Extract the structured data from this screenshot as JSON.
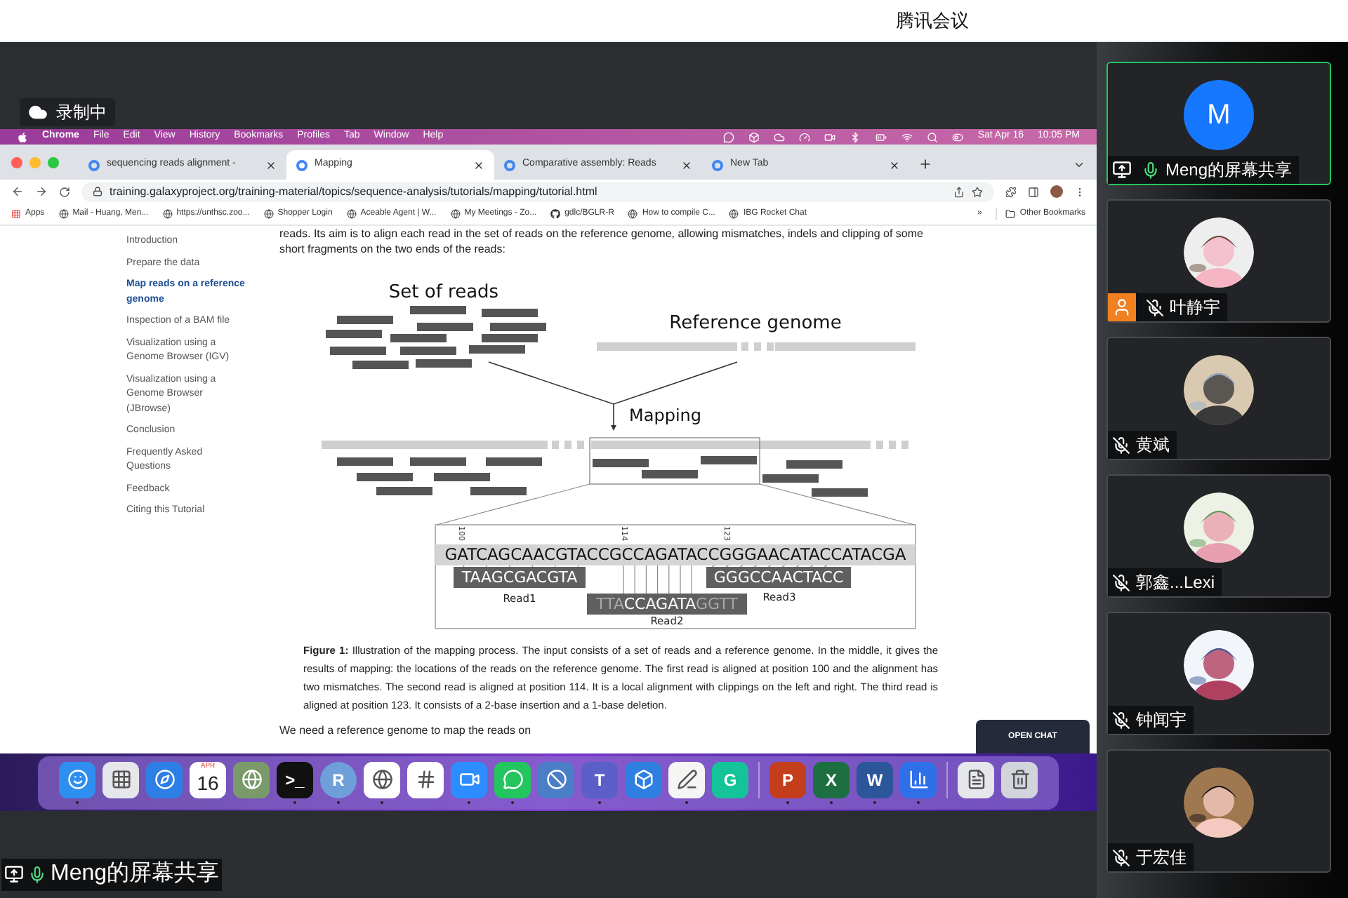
{
  "app_title": "腾讯会议",
  "recording": {
    "label": "录制中"
  },
  "menubar": {
    "items": [
      "Chrome",
      "File",
      "Edit",
      "View",
      "History",
      "Bookmarks",
      "Profiles",
      "Tab",
      "Window",
      "Help"
    ],
    "date": "Sat Apr 16",
    "time": "10:05 PM"
  },
  "browser": {
    "tabs": [
      {
        "title": "sequencing reads alignment - ",
        "selected": false
      },
      {
        "title": "Mapping",
        "selected": true
      },
      {
        "title": "Comparative assembly: Reads",
        "selected": false
      },
      {
        "title": "New Tab",
        "selected": false
      }
    ],
    "address": "training.galaxyproject.org/training-material/topics/sequence-analysis/tutorials/mapping/tutorial.html",
    "bookmarks": [
      "Apps",
      "Mail - Huang, Men...",
      "https://unthsc.zoo...",
      "Shopper Login",
      "Aceable Agent | W...",
      "My Meetings - Zo...",
      "gdlc/BGLR-R",
      "How to compile C...",
      "IBG Rocket Chat"
    ],
    "bookmarks_more": "»",
    "other_bookmarks": "Other Bookmarks"
  },
  "sidebar": {
    "items": [
      {
        "label": "Introduction",
        "selected": false
      },
      {
        "label": "Prepare the data",
        "selected": false
      },
      {
        "label": "Map reads on a reference genome",
        "selected": true
      },
      {
        "label": "Inspection of a BAM file",
        "selected": false
      },
      {
        "label": "Visualization using a Genome Browser (IGV)",
        "selected": false
      },
      {
        "label": "Visualization using a Genome Browser (JBrowse)",
        "selected": false
      },
      {
        "label": "Conclusion",
        "selected": false
      },
      {
        "label": "Frequently Asked Questions",
        "selected": false
      },
      {
        "label": "Feedback",
        "selected": false
      },
      {
        "label": "Citing this Tutorial",
        "selected": false
      }
    ]
  },
  "article": {
    "intro": "reads. Its aim is to align each read in the set of reads on the reference genome, allowing mismatches, indels and clipping of some short fragments on the two ends of the reads:",
    "figure": {
      "reads_title": "Set of reads",
      "reference_title": "Reference genome",
      "mapping_label": "Mapping",
      "positions": [
        "100",
        "114",
        "123"
      ],
      "reference_sequence": "GATCAGCAACGTACCGCCAGATACCGGGAACATACCATACGA",
      "reads": [
        {
          "label": "Read1",
          "sequence": "TAAGCGACGTA"
        },
        {
          "label": "Read2",
          "left_clip": "TTA",
          "sequence": "CCAGATA",
          "right_clip": "GGTT"
        },
        {
          "label": "Read3",
          "sequence": "GGGCCAACTACC"
        }
      ]
    },
    "caption": "**Figure 1:** Illustration of the mapping process. The input consists of a set of reads and a reference genome. In the middle, it gives the results of mapping: the locations of the reads on the reference genome. The first read is aligned at position 100 and the alignment has two mismatches. The second read is aligned at position 114. It is a local alignment with clippings on the left and right. The third read is aligned at position 123. It consists of a 2-base insertion and a 1-base deletion.",
    "next": "We need a reference genome to map the reads on"
  },
  "open_chat": "OPEN CHAT",
  "dock": [
    {
      "kind": "face",
      "color": "#2f8ff0",
      "running": true
    },
    {
      "kind": "grid",
      "color": "#e5e7eb",
      "running": false
    },
    {
      "kind": "compass",
      "color": "#2d7fe6",
      "running": false
    },
    {
      "kind": "calendar",
      "month": "APR",
      "day": "16",
      "running": false
    },
    {
      "kind": "ring",
      "color": "#7a9a6a",
      "running": false
    },
    {
      "kind": "letter",
      "glyph": ">_",
      "color": "#111111",
      "running": true
    },
    {
      "kind": "letter",
      "glyph": "R",
      "color": "#6f9fd8",
      "running": true
    },
    {
      "kind": "chrome",
      "color": "#ffffff",
      "running": true
    },
    {
      "kind": "hash",
      "color": "#ffffff",
      "running": false
    },
    {
      "kind": "video",
      "color": "#2d8cff",
      "running": true
    },
    {
      "kind": "chat",
      "color": "#22c55e",
      "running": true
    },
    {
      "kind": "ban",
      "color": "#4a7fc8",
      "running": false
    },
    {
      "kind": "letter",
      "glyph": "T",
      "color": "#5b5fc7",
      "running": true
    },
    {
      "kind": "box",
      "color": "#2f7fe0",
      "running": false
    },
    {
      "kind": "pen",
      "color": "#f5f5f4",
      "running": true
    },
    {
      "kind": "letter",
      "glyph": "G",
      "color": "#15c39a",
      "running": false
    },
    {
      "kind": "separator"
    },
    {
      "kind": "letter",
      "glyph": "P",
      "color": "#c43e1c",
      "running": true
    },
    {
      "kind": "letter",
      "glyph": "X",
      "color": "#1d6f42",
      "running": true
    },
    {
      "kind": "letter",
      "glyph": "W",
      "color": "#2b579a",
      "running": true
    },
    {
      "kind": "chart",
      "color": "#2f6fe8",
      "running": true
    },
    {
      "kind": "separator"
    },
    {
      "kind": "file",
      "color": "#e5e7eb",
      "running": false
    },
    {
      "kind": "trash",
      "color": "#d1d5db",
      "running": false
    }
  ],
  "participants": [
    {
      "name": "Meng的屏幕共享",
      "avatar": {
        "kind": "letter",
        "letter": "M"
      },
      "highlighted": true,
      "sharing": true,
      "host": false,
      "muted": false
    },
    {
      "name": "叶静宇",
      "highlighted": false,
      "sharing": false,
      "host": true,
      "muted": true
    },
    {
      "name": "黄斌",
      "highlighted": false,
      "sharing": false,
      "host": false,
      "muted": true
    },
    {
      "name": "郭鑫...Lexi",
      "highlighted": false,
      "sharing": false,
      "host": false,
      "muted": true
    },
    {
      "name": "钟闻宇",
      "highlighted": false,
      "sharing": false,
      "host": false,
      "muted": true
    },
    {
      "name": "于宏佳",
      "highlighted": false,
      "sharing": false,
      "host": false,
      "muted": true
    }
  ],
  "share_label": {
    "name": "Meng的屏幕共享",
    "sharing": true,
    "muted": false
  }
}
